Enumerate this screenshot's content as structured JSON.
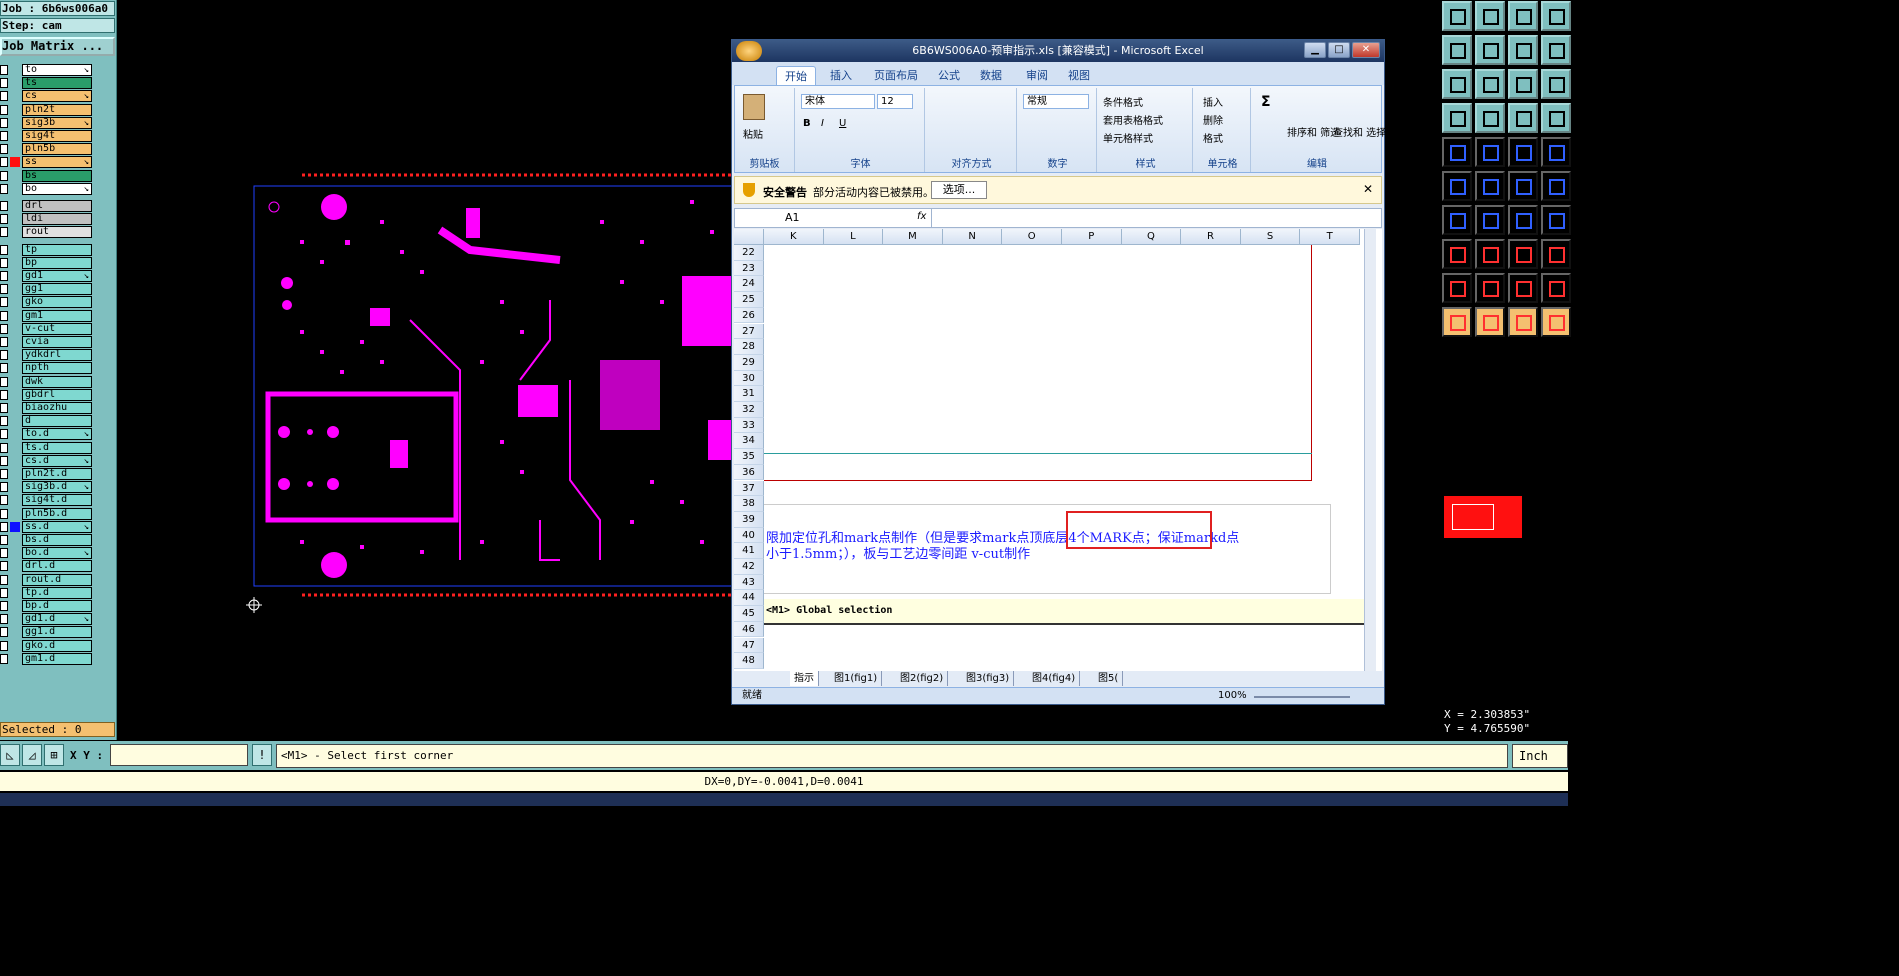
{
  "left_panel": {
    "job": "Job : 6b6ws006a0",
    "step": "Step: cam",
    "matrix_button": "Job Matrix ...",
    "layers": [
      {
        "name": "to",
        "color": "#ffffff",
        "mark": "↘"
      },
      {
        "name": "ts",
        "color": "#2a9d6a",
        "mark": ""
      },
      {
        "name": "cs",
        "color": "#f4c070",
        "mark": "↘"
      },
      {
        "name": "pln2t",
        "color": "#f4c070",
        "mark": ""
      },
      {
        "name": "sig3b",
        "color": "#f4c070",
        "mark": "↘"
      },
      {
        "name": "sig4t",
        "color": "#f4c070",
        "mark": ""
      },
      {
        "name": "pln5b",
        "color": "#f4c070",
        "mark": ""
      },
      {
        "name": "ss",
        "color": "#f4c070",
        "mark": "↘"
      },
      {
        "name": "bs",
        "color": "#2a9d6a",
        "mark": ""
      },
      {
        "name": "bo",
        "color": "#ffffff",
        "mark": "↘"
      },
      {
        "name": "drl",
        "color": "#c0c0c0",
        "mark": ""
      },
      {
        "name": "ldi",
        "color": "#c0c0c0",
        "mark": ""
      },
      {
        "name": "rout",
        "color": "#e0e0e0",
        "mark": ""
      },
      {
        "name": "tp",
        "color": "#7fd8d0",
        "mark": ""
      },
      {
        "name": "bp",
        "color": "#7fd8d0",
        "mark": ""
      },
      {
        "name": "gd1",
        "color": "#7fd8d0",
        "mark": "↘"
      },
      {
        "name": "gg1",
        "color": "#7fd8d0",
        "mark": ""
      },
      {
        "name": "gko",
        "color": "#7fd8d0",
        "mark": ""
      },
      {
        "name": "gm1",
        "color": "#7fd8d0",
        "mark": ""
      },
      {
        "name": "v-cut",
        "color": "#7fd8d0",
        "mark": ""
      },
      {
        "name": "cvia",
        "color": "#7fd8d0",
        "mark": ""
      },
      {
        "name": "ydkdrl",
        "color": "#7fd8d0",
        "mark": ""
      },
      {
        "name": "npth",
        "color": "#7fd8d0",
        "mark": ""
      },
      {
        "name": "dwk",
        "color": "#7fd8d0",
        "mark": ""
      },
      {
        "name": "gbdrl",
        "color": "#7fd8d0",
        "mark": ""
      },
      {
        "name": "biaozhu",
        "color": "#7fd8d0",
        "mark": ""
      },
      {
        "name": "d",
        "color": "#7fd8d0",
        "mark": ""
      },
      {
        "name": "to.d",
        "color": "#7fd8d0",
        "mark": "↘"
      },
      {
        "name": "ts.d",
        "color": "#7fd8d0",
        "mark": ""
      },
      {
        "name": "cs.d",
        "color": "#7fd8d0",
        "mark": "↘"
      },
      {
        "name": "pln2t.d",
        "color": "#7fd8d0",
        "mark": ""
      },
      {
        "name": "sig3b.d",
        "color": "#7fd8d0",
        "mark": "↘"
      },
      {
        "name": "sig4t.d",
        "color": "#7fd8d0",
        "mark": ""
      },
      {
        "name": "pln5b.d",
        "color": "#7fd8d0",
        "mark": ""
      },
      {
        "name": "ss.d",
        "color": "#7fd8d0",
        "mark": "↘"
      },
      {
        "name": "bs.d",
        "color": "#7fd8d0",
        "mark": ""
      },
      {
        "name": "bo.d",
        "color": "#7fd8d0",
        "mark": "↘"
      },
      {
        "name": "drl.d",
        "color": "#7fd8d0",
        "mark": ""
      },
      {
        "name": "rout.d",
        "color": "#7fd8d0",
        "mark": ""
      },
      {
        "name": "tp.d",
        "color": "#7fd8d0",
        "mark": ""
      },
      {
        "name": "bp.d",
        "color": "#7fd8d0",
        "mark": ""
      },
      {
        "name": "gd1.d",
        "color": "#7fd8d0",
        "mark": "↘"
      },
      {
        "name": "gg1.d",
        "color": "#7fd8d0",
        "mark": ""
      },
      {
        "name": "gko.d",
        "color": "#7fd8d0",
        "mark": ""
      },
      {
        "name": "gm1.d",
        "color": "#7fd8d0",
        "mark": ""
      }
    ],
    "selected": "Selected : 0"
  },
  "command_bar": {
    "xy_label": "X Y :",
    "xy_value": "",
    "help_label": "!",
    "prompt": "<M1> - Select first corner",
    "units": "Inch"
  },
  "delta_readout": "DX=0,DY=-0.0041,D=0.0041",
  "coords": {
    "x": "X = 2.303853\"",
    "y": "Y = 4.765590\""
  },
  "excel": {
    "title": "6B6WS006A0-预审指示.xls  [兼容模式] - Microsoft Excel",
    "tabs": [
      "开始",
      "插入",
      "页面布局",
      "公式",
      "数据",
      "审阅",
      "视图"
    ],
    "ribbon": {
      "paste": "粘贴",
      "clipboard": "剪贴板",
      "font_name": "宋体",
      "font_size": "12",
      "font": "字体",
      "align": "对齐方式",
      "number_format": "常规",
      "number": "数字",
      "cond_format": "条件格式",
      "table_format": "套用表格格式",
      "cell_style": "单元格样式",
      "styles": "样式",
      "insert": "插入",
      "delete": "删除",
      "format": "格式",
      "cells": "单元格",
      "sort": "排序和\n筛选",
      "find": "查找和\n选择",
      "edit": "编辑"
    },
    "security": {
      "label": "安全警告",
      "text": "部分活动内容已被禁用。",
      "button": "选项..."
    },
    "name_box": "A1",
    "fx": "fx",
    "columns": [
      "K",
      "L",
      "M",
      "N",
      "O",
      "P",
      "Q",
      "R",
      "S",
      "T"
    ],
    "rows": [
      "22",
      "23",
      "24",
      "25",
      "26",
      "27",
      "28",
      "29",
      "30",
      "31",
      "32",
      "33",
      "34",
      "35",
      "36",
      "37",
      "38",
      "39",
      "40",
      "41",
      "42",
      "43",
      "44",
      "45",
      "46",
      "47",
      "48"
    ],
    "note_line1": "限加定位孔和mark点制作（但是要求mark点顶底层4个MARK点；保证markd点",
    "note_line2": "小于1.5mm；），板与工艺边零间距 v-cut制作",
    "global_selection": "<M1> Global selection",
    "sheets": [
      "指示",
      "图1(fig1)",
      "图2(fig2)",
      "图3(fig3)",
      "图4(fig4)",
      "图5("
    ],
    "status": "就绪",
    "zoom": "100%"
  }
}
